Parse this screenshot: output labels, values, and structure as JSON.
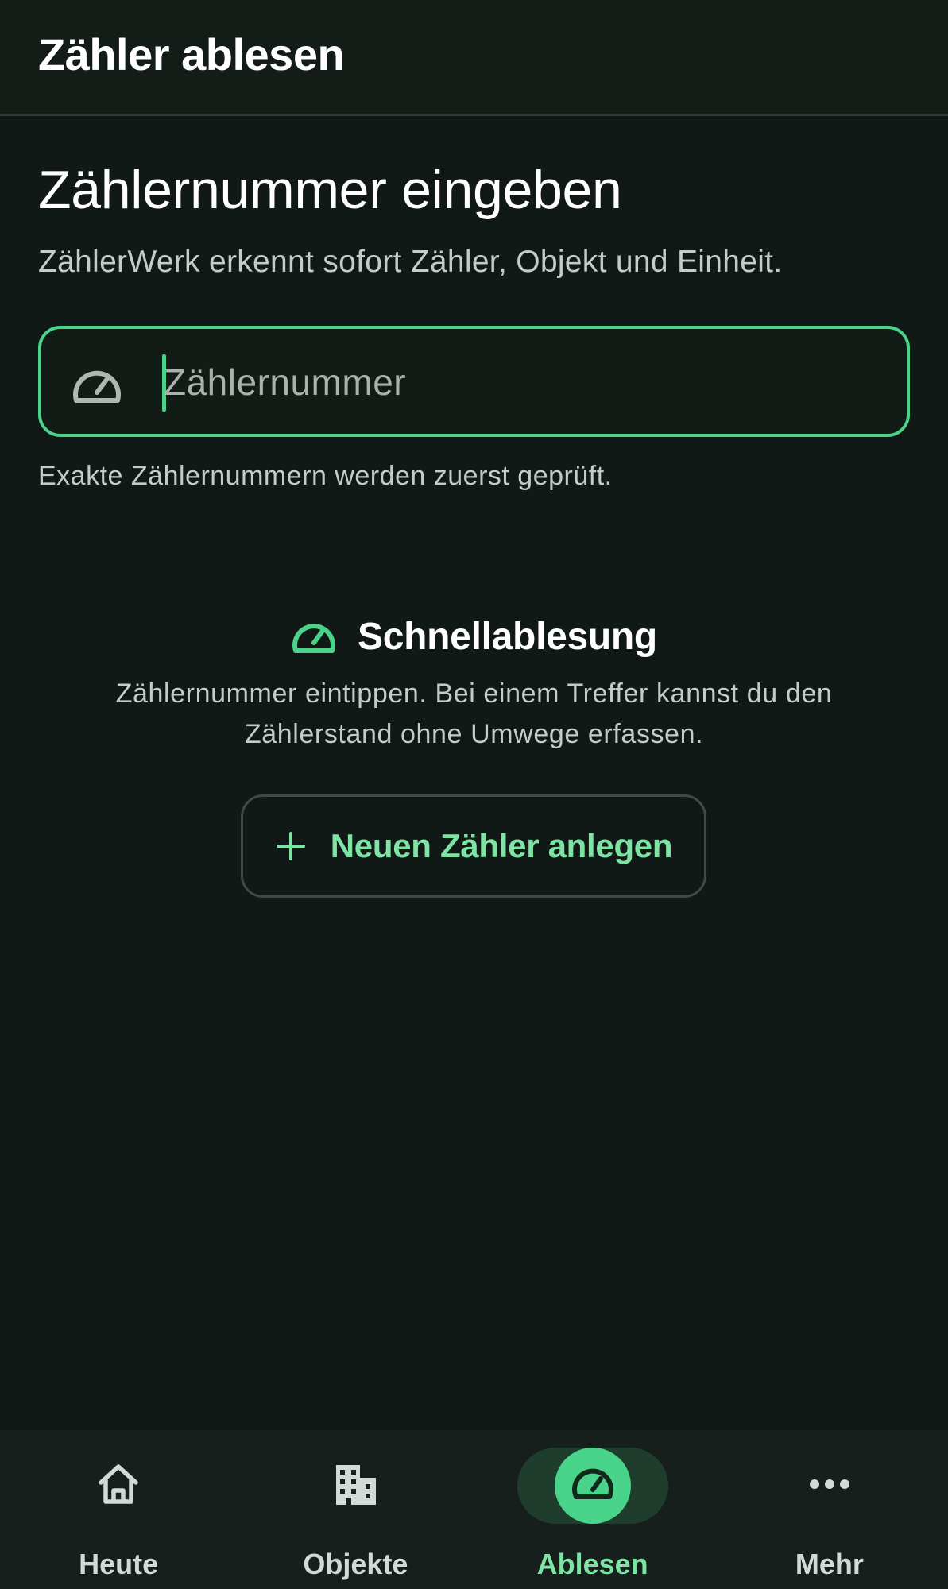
{
  "topbar": {
    "title": "Zähler ablesen"
  },
  "main": {
    "heading": "Zählernummer eingeben",
    "subheading": "ZählerWerk erkennt sofort Zähler, Objekt und Einheit.",
    "meter_input": {
      "placeholder": "Zählernummer",
      "value": "",
      "icon": "gauge-icon"
    },
    "helper_text": "Exakte Zählernummern werden zuerst geprüft."
  },
  "quick_reading": {
    "icon": "gauge-icon",
    "title": "Schnellablesung",
    "description": "Zählernummer eintippen. Bei einem Treffer kannst du den Zählerstand ohne Umwege erfassen.",
    "button_label": "Neuen Zähler anlegen",
    "button_icon": "plus-icon"
  },
  "bottom_nav": {
    "items": [
      {
        "label": "Heute",
        "icon": "home-icon",
        "active": false
      },
      {
        "label": "Objekte",
        "icon": "building-icon",
        "active": false
      },
      {
        "label": "Ablesen",
        "icon": "gauge-icon",
        "active": true
      },
      {
        "label": "Mehr",
        "icon": "more-horizontal-icon",
        "active": false
      }
    ]
  },
  "colors": {
    "background": "#111916",
    "accent": "#4ad38a",
    "accent_text": "#7fe3a6",
    "active_pill": "#1e3d2c"
  }
}
